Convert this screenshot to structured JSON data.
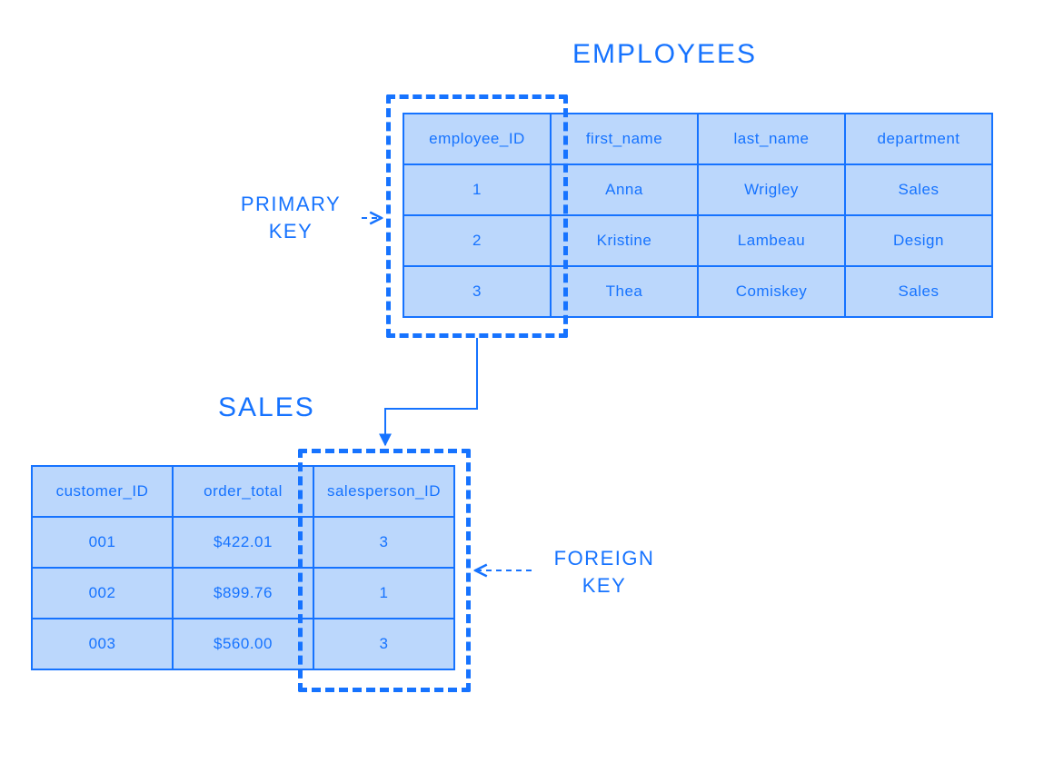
{
  "colors": {
    "accent": "#1673ff",
    "cell_bg": "#bbd7fc"
  },
  "titles": {
    "employees": "EMPLOYEES",
    "sales": "SALES"
  },
  "labels": {
    "primary_key_line1": "PRIMARY",
    "primary_key_line2": "KEY",
    "foreign_key_line1": "FOREIGN",
    "foreign_key_line2": "KEY"
  },
  "employees_table": {
    "headers": [
      "employee_ID",
      "first_name",
      "last_name",
      "department"
    ],
    "rows": [
      [
        "1",
        "Anna",
        "Wrigley",
        "Sales"
      ],
      [
        "2",
        "Kristine",
        "Lambeau",
        "Design"
      ],
      [
        "3",
        "Thea",
        "Comiskey",
        "Sales"
      ]
    ]
  },
  "sales_table": {
    "headers": [
      "customer_ID",
      "order_total",
      "salesperson_ID"
    ],
    "rows": [
      [
        "001",
        "$422.01",
        "3"
      ],
      [
        "002",
        "$899.76",
        "1"
      ],
      [
        "003",
        "$560.00",
        "3"
      ]
    ]
  }
}
